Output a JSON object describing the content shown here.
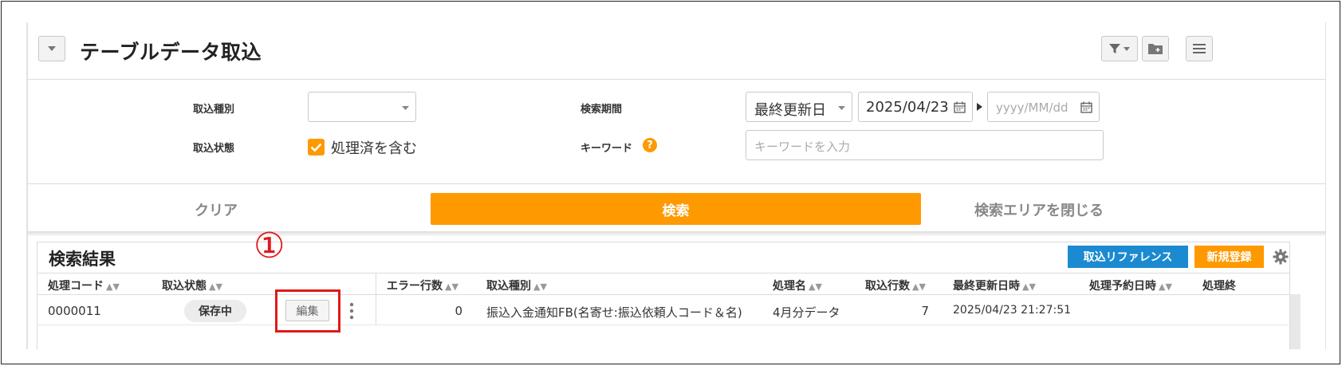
{
  "header": {
    "title": "テーブルデータ取込"
  },
  "search": {
    "import_type_label": "取込種別",
    "import_type_value": "",
    "status_label": "取込状態",
    "include_processed_label": "処理済を含む",
    "include_processed_checked": true,
    "period_label": "検索期間",
    "period_type_value": "最終更新日",
    "date_from": "2025/04/23",
    "date_to_placeholder": "yyyy/MM/dd",
    "keyword_label": "キーワード",
    "keyword_placeholder": "キーワードを入力"
  },
  "actions": {
    "clear_label": "クリア",
    "search_label": "検索",
    "close_label": "検索エリアを閉じる"
  },
  "results": {
    "title": "検索結果",
    "reference_button": "取込リファレンス",
    "new_button": "新規登録",
    "columns": [
      "処理コード",
      "取込状態",
      "エラー行数",
      "取込種別",
      "処理名",
      "取込行数",
      "最終更新日時",
      "処理予約日時",
      "処理終"
    ],
    "rows": [
      {
        "code": "0000011",
        "status": "保存中",
        "edit_label": "編集",
        "error_rows": "0",
        "import_type": "振込入金通知FB(名寄せ:振込依頼人コード＆名)",
        "process_name": "4月分データ",
        "import_rows": "7",
        "updated_at": "2025/04/23 21:27:51",
        "scheduled_at": ""
      }
    ]
  },
  "annotation": {
    "callout_number": "①"
  },
  "colors": {
    "accent_orange": "#ff9900",
    "accent_blue": "#1b8ad0",
    "highlight_red": "#e11919"
  }
}
